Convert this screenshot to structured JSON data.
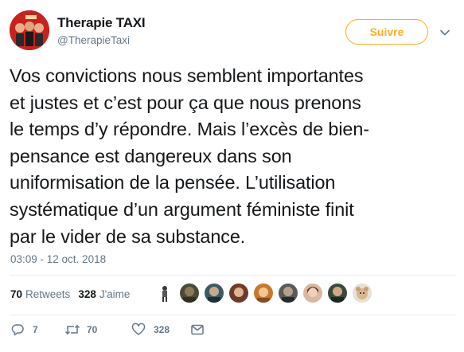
{
  "account": {
    "name": "Therapie TAXI",
    "handle": "@TherapieTaxi"
  },
  "follow_button": {
    "label": "Suivre",
    "color": "#ffad1f"
  },
  "tweet": {
    "lines": [
      "Vos convictions nous semblent importantes",
      "et justes et c’est pour ça que nous prenons",
      "le temps d’y répondre. Mais l’excès de bien-",
      "pensance est dangereux dans son",
      "uniformisation de la pensée. L’utilisation",
      "systématique d’un argument féministe finit",
      "par le vider de sa substance."
    ],
    "timestamp": "03:09 - 12 oct. 2018"
  },
  "stats": {
    "retweets_count": "70",
    "retweets_label": "Retweets",
    "likes_count": "328",
    "likes_label": "J'aime"
  },
  "liker_avatars": [
    "figure",
    "person",
    "person",
    "person",
    "person",
    "person",
    "person",
    "person",
    "dog"
  ],
  "actions": {
    "replies": "7",
    "retweets": "70",
    "likes": "328"
  },
  "colors": {
    "text": "#14171a",
    "secondary": "#657786",
    "accent": "#ffad1f",
    "divider": "#e6ecf0"
  }
}
